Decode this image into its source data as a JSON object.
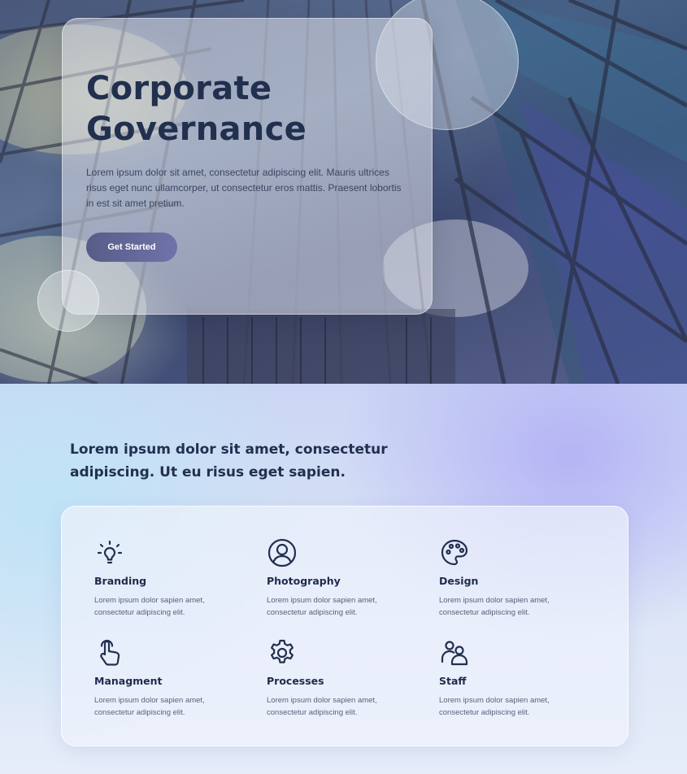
{
  "hero": {
    "title_line1": "Corporate",
    "title_line2": "Governance",
    "description": "Lorem ipsum dolor sit amet, consectetur adipiscing elit. Mauris ultrices risus eget nunc ullamcorper, ut consectetur eros mattis. Praesent lobortis in est sit amet pretium.",
    "cta_label": "Get Started"
  },
  "section": {
    "heading": "Lorem ipsum dolor sit amet, consectetur adipiscing. Ut eu risus eget sapien."
  },
  "features": [
    {
      "title": "Branding",
      "description": "Lorem ipsum dolor sapien amet, consectetur adipiscing elit.",
      "icon": "lightbulb-icon"
    },
    {
      "title": "Photography",
      "description": "Lorem ipsum dolor sapien amet, consectetur adipiscing elit.",
      "icon": "user-circle-icon"
    },
    {
      "title": "Design",
      "description": "Lorem ipsum dolor sapien amet, consectetur adipiscing elit.",
      "icon": "palette-icon"
    },
    {
      "title": "Managment",
      "description": "Lorem ipsum dolor sapien amet, consectetur adipiscing elit.",
      "icon": "pointer-hand-icon"
    },
    {
      "title": "Processes",
      "description": "Lorem ipsum dolor sapien amet, consectetur adipiscing elit.",
      "icon": "gear-icon"
    },
    {
      "title": "Staff",
      "description": "Lorem ipsum dolor sapien amet, consectetur adipiscing elit.",
      "icon": "users-icon"
    }
  ],
  "colors": {
    "heading": "#22304f",
    "button_start": "#575c88",
    "button_end": "#6f73a8"
  }
}
